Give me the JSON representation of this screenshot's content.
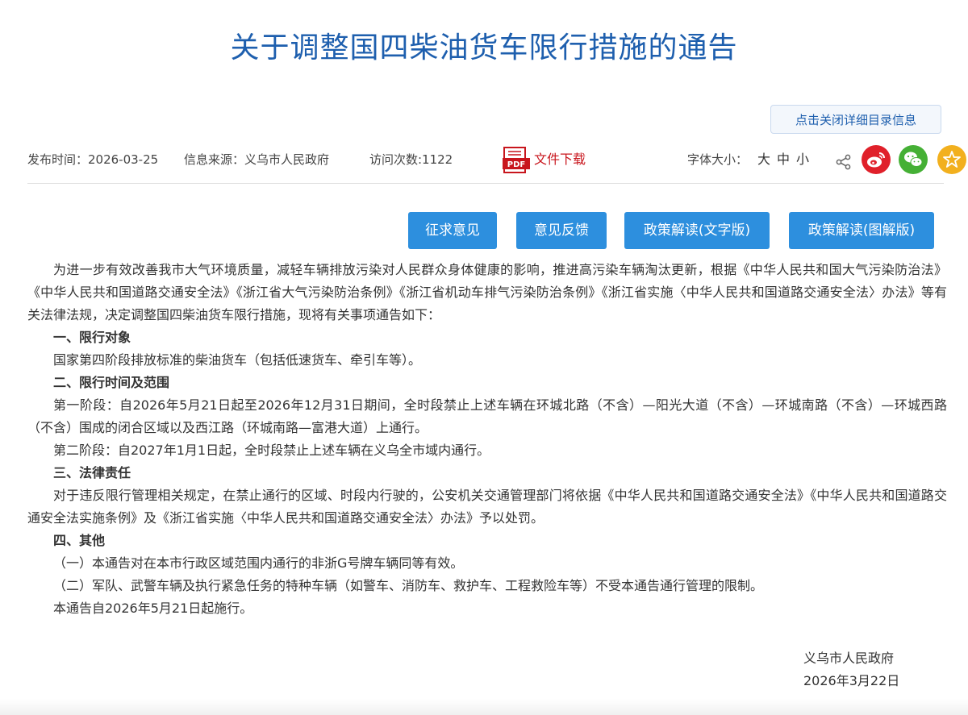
{
  "title": "关于调整国四柴油货车限行措施的通告",
  "toggle_catalog": "点击关闭详细目录信息",
  "meta": {
    "publish": "发布时间：2026-03-25",
    "source": "信息来源：义乌市人民政府",
    "visits": "访问次数:1122",
    "pdf_label": "PDF",
    "download": "文件下载",
    "font_size_label": "字体大小：",
    "font_large": "大",
    "font_medium": "中",
    "font_small": "小"
  },
  "icons": {
    "share": "share-icon",
    "weibo": "weibo-icon",
    "wechat": "wechat-icon",
    "favorite": "star-icon"
  },
  "colors": {
    "title": "#1e5fae",
    "button": "#2d8fde",
    "download": "#c8161d",
    "weibo": "#e0202a",
    "wechat": "#45b035",
    "favorite": "#f2b01e"
  },
  "buttons": {
    "solicit": "征求意见",
    "feedback": "意见反馈",
    "interpret_text": "政策解读(文字版)",
    "interpret_graphic": "政策解读(图解版)"
  },
  "body": {
    "intro": "为进一步有效改善我市大气环境质量，减轻车辆排放污染对人民群众身体健康的影响，推进高污染车辆淘汰更新，根据《中华人民共和国大气污染防治法》《中华人民共和国道路交通安全法》《浙江省大气污染防治条例》《浙江省机动车排气污染防治条例》《浙江省实施〈中华人民共和国道路交通安全法〉办法》等有关法律法规，决定调整国四柴油货车限行措施，现将有关事项通告如下：",
    "h1": "一、限行对象",
    "p1": "国家第四阶段排放标准的柴油货车（包括低速货车、牵引车等）。",
    "h2": "二、限行时间及范围",
    "p2a": "第一阶段：自2026年5月21日起至2026年12月31日期间，全时段禁止上述车辆在环城北路（不含）—阳光大道（不含）—环城南路（不含）—环城西路（不含）围成的闭合区域以及西江路（环城南路—富港大道）上通行。",
    "p2b": "第二阶段：自2027年1月1日起，全时段禁止上述车辆在义乌全市域内通行。",
    "h3": "三、法律责任",
    "p3": "对于违反限行管理相关规定，在禁止通行的区域、时段内行驶的，公安机关交通管理部门将依据《中华人民共和国道路交通安全法》《中华人民共和国道路交通安全法实施条例》及《浙江省实施〈中华人民共和国道路交通安全法〉办法》予以处罚。",
    "h4": "四、其他",
    "p4a": "（一）本通告对在本市行政区域范围内通行的非浙G号牌车辆同等有效。",
    "p4b": "（二）军队、武警车辆及执行紧急任务的特种车辆（如警车、消防车、救护车、工程救险车等）不受本通告通行管理的限制。",
    "p5": "本通告自2026年5月21日起施行。"
  },
  "signature": {
    "org": "义乌市人民政府",
    "date": "2026年3月22日"
  }
}
